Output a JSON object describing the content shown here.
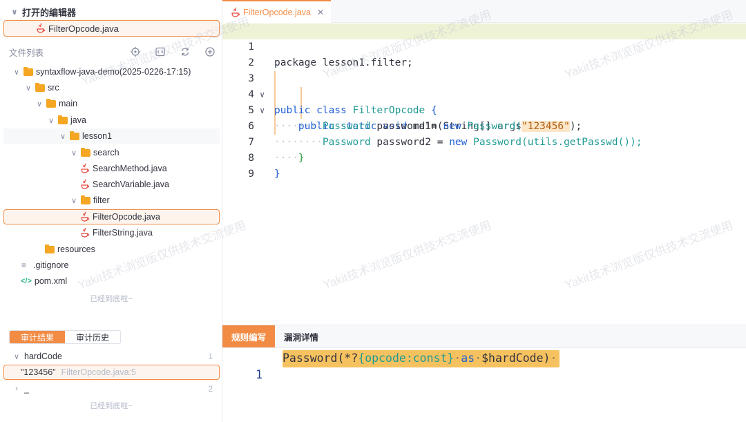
{
  "open_editors": {
    "title": "打开的编辑器",
    "file": "FilterOpcode.java"
  },
  "file_list": {
    "title": "文件列表",
    "tree": [
      {
        "label": "syntaxflow-java-demo(2025-0226-17:15)",
        "type": "folder",
        "depth": 0,
        "expanded": true
      },
      {
        "label": "src",
        "type": "folder",
        "depth": 1,
        "expanded": true
      },
      {
        "label": "main",
        "type": "folder",
        "depth": 2,
        "expanded": true
      },
      {
        "label": "java",
        "type": "folder",
        "depth": 3,
        "expanded": true
      },
      {
        "label": "lesson1",
        "type": "folder",
        "depth": 4,
        "expanded": true
      },
      {
        "label": "search",
        "type": "folder",
        "depth": 5,
        "expanded": true
      },
      {
        "label": "SearchMethod.java",
        "type": "java",
        "depth": 6
      },
      {
        "label": "SearchVariable.java",
        "type": "java",
        "depth": 6
      },
      {
        "label": "filter",
        "type": "folder",
        "depth": 5,
        "expanded": true
      },
      {
        "label": "FilterOpcode.java",
        "type": "java",
        "depth": 6,
        "selected": true
      },
      {
        "label": "FilterString.java",
        "type": "java",
        "depth": 6
      },
      {
        "label": "resources",
        "type": "folder",
        "depth": 2,
        "expanded": false
      },
      {
        "label": ".gitignore",
        "type": "text",
        "depth": 0
      },
      {
        "label": "pom.xml",
        "type": "xml",
        "depth": 0
      }
    ],
    "end_hint": "已经到底啦~"
  },
  "audit": {
    "tabs": [
      "审计结果",
      "审计历史"
    ],
    "results": [
      {
        "label": "hardCode",
        "count": "1",
        "expanded": true
      },
      {
        "label": "\"123456\"",
        "location": "FilterOpcode.java:5",
        "child": true
      },
      {
        "label": "_",
        "count": "2",
        "expanded": false
      }
    ],
    "end_hint": "已经到底啦~"
  },
  "editor": {
    "tab_label": "FilterOpcode.java",
    "line_numbers": [
      "1",
      "2",
      "3",
      "4",
      "5",
      "6",
      "7",
      "8",
      "9"
    ],
    "lines": {
      "l1": "package lesson1.filter;",
      "l3_kw": "public class",
      "l3_cls": "FilterOpcode",
      "l4_a": "public static void",
      "l4_b": "main(String[] args)",
      "l5_cls": "Password",
      "l5_var": "password1=",
      "l5_kw": "new",
      "l5_ctor": "Password(",
      "l5_str": "\"123456\"",
      "l5_end": ");",
      "l6_cls": "Password",
      "l6_var": "password2 =",
      "l6_kw": "new",
      "l6_ctor": "Password(utils.getPasswd());",
      "l7": "}",
      "l8": "}"
    }
  },
  "rule_panel": {
    "tabs": [
      "规则编写",
      "漏洞详情"
    ],
    "line_number": "1",
    "rule_a": "Password(*?",
    "rule_b": "{opcode:const}",
    "rule_c": "as",
    "rule_d": "$hardCode)"
  },
  "watermark": "Yakit技术浏览版仅供技术交流使用",
  "colors": {
    "accent": "#f28b44",
    "keyword": "#1f5fd6",
    "class": "#1f9a93",
    "string_bg": "#fbe6c8",
    "rule_bg": "#f6c25f"
  }
}
